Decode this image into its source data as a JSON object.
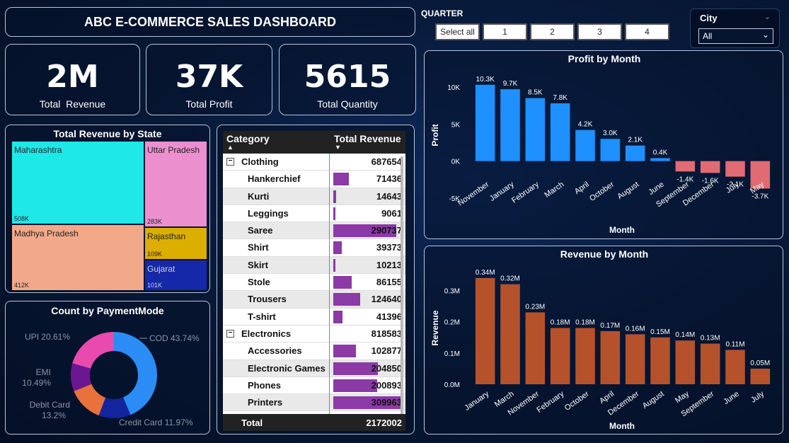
{
  "header": {
    "title": "ABC E-COMMERCE SALES DASHBOARD"
  },
  "kpis": [
    {
      "value": "2M",
      "label": "Total  Revenue"
    },
    {
      "value": "37K",
      "label": "Total Profit"
    },
    {
      "value": "5615",
      "label": "Total Quantity"
    }
  ],
  "quarter_slicer": {
    "title": "QUARTER",
    "buttons": [
      "Select all",
      "1",
      "2",
      "3",
      "4"
    ]
  },
  "city_slicer": {
    "title": "City",
    "selected": "All"
  },
  "treemap": {
    "title": "Total Revenue by State",
    "tiles": [
      {
        "label": "Maharashtra",
        "value": "508K",
        "color": "#1ee8e8"
      },
      {
        "label": "Uttar Pradesh",
        "value": "283K",
        "color": "#ec8fcf"
      },
      {
        "label": "Madhya Pradesh",
        "value": "412K",
        "color": "#f2a98a"
      },
      {
        "label": "Rajasthan",
        "value": "109K",
        "color": "#dcae00"
      },
      {
        "label": "Gujarat",
        "value": "101K",
        "color": "#1428a8"
      }
    ]
  },
  "donut": {
    "title": "Count by PaymentMode",
    "slices": [
      {
        "name": "COD",
        "pct": 43.74,
        "label": "COD 43.74%",
        "color": "#2b8cf5"
      },
      {
        "name": "Credit Card",
        "pct": 11.97,
        "label": "Credit Card 11.97%",
        "color": "#12259e"
      },
      {
        "name": "Debit Card",
        "pct": 13.2,
        "label1": "Debit Card",
        "label2": "13.2%",
        "color": "#e8713c"
      },
      {
        "name": "EMI",
        "pct": 10.49,
        "label1": "EMI",
        "label2": "10.49%",
        "color": "#6b1790"
      },
      {
        "name": "UPI",
        "pct": 20.61,
        "label": "UPI 20.61%",
        "color": "#e94aae"
      }
    ]
  },
  "table": {
    "col1": "Category",
    "col2": "Total Revenue",
    "bar_color": "#8b3aa6",
    "rows": [
      {
        "type": "group",
        "label": "Clothing",
        "value": "687654",
        "num": 687654,
        "toggle": "−"
      },
      {
        "type": "item",
        "label": "Hankerchief",
        "value": "71436",
        "num": 71436
      },
      {
        "type": "item",
        "label": "Kurti",
        "value": "14643",
        "num": 14643
      },
      {
        "type": "item",
        "label": "Leggings",
        "value": "9061",
        "num": 9061
      },
      {
        "type": "item",
        "label": "Saree",
        "value": "290737",
        "num": 290737
      },
      {
        "type": "item",
        "label": "Shirt",
        "value": "39373",
        "num": 39373
      },
      {
        "type": "item",
        "label": "Skirt",
        "value": "10213",
        "num": 10213
      },
      {
        "type": "item",
        "label": "Stole",
        "value": "86155",
        "num": 86155
      },
      {
        "type": "item",
        "label": "Trousers",
        "value": "124640",
        "num": 124640
      },
      {
        "type": "item",
        "label": "T-shirt",
        "value": "41396",
        "num": 41396
      },
      {
        "type": "group",
        "label": "Electronics",
        "value": "818583",
        "num": 818583,
        "toggle": "−"
      },
      {
        "type": "item",
        "label": "Accessories",
        "value": "102877",
        "num": 102877
      },
      {
        "type": "item",
        "label": "Electronic Games",
        "value": "204850",
        "num": 204850
      },
      {
        "type": "item",
        "label": "Phones",
        "value": "200893",
        "num": 200893
      },
      {
        "type": "item",
        "label": "Printers",
        "value": "309963",
        "num": 309963
      }
    ],
    "total_label": "Total",
    "total_value": "2172002"
  },
  "chart_data": [
    {
      "type": "bar",
      "title": "Profit by Month",
      "xlabel": "Month",
      "ylabel": "Profit",
      "ylim": [
        -5000,
        12000
      ],
      "yticks": [
        10000,
        5000,
        0,
        -5000
      ],
      "ytick_labels": [
        "10K",
        "5K",
        "0K",
        "-5K"
      ],
      "categories": [
        "November",
        "January",
        "February",
        "March",
        "April",
        "October",
        "August",
        "June",
        "September",
        "December",
        "July",
        "May"
      ],
      "values": [
        10300,
        9700,
        8500,
        7800,
        4200,
        3000,
        2100,
        400,
        -1400,
        -1600,
        -2100,
        -3700
      ],
      "data_labels": [
        "10.3K",
        "9.7K",
        "8.5K",
        "7.8K",
        "4.2K",
        "3.0K",
        "2.1K",
        "0.4K",
        "-1.4K",
        "-1.6K",
        "-2.1K",
        "-3.7K"
      ],
      "colors": {
        "positive": "#1e90ff",
        "negative": "#e06b73"
      },
      "grid": false
    },
    {
      "type": "bar",
      "title": "Revenue by Month",
      "xlabel": "Month",
      "ylabel": "Revenue",
      "ylim": [
        0,
        0.36
      ],
      "yticks": [
        0,
        0.1,
        0.2,
        0.3
      ],
      "ytick_labels": [
        "0.0M",
        "0.1M",
        "0.2M",
        "0.3M"
      ],
      "categories": [
        "January",
        "March",
        "November",
        "February",
        "October",
        "April",
        "December",
        "August",
        "May",
        "September",
        "June",
        "July"
      ],
      "values": [
        0.34,
        0.32,
        0.23,
        0.18,
        0.18,
        0.17,
        0.16,
        0.15,
        0.14,
        0.13,
        0.11,
        0.05
      ],
      "data_labels": [
        "0.34M",
        "0.32M",
        "0.23M",
        "0.18M",
        "0.18M",
        "0.17M",
        "0.16M",
        "0.15M",
        "0.14M",
        "0.13M",
        "0.11M",
        "0.05M"
      ],
      "color": "#b5522c",
      "grid": false
    }
  ]
}
